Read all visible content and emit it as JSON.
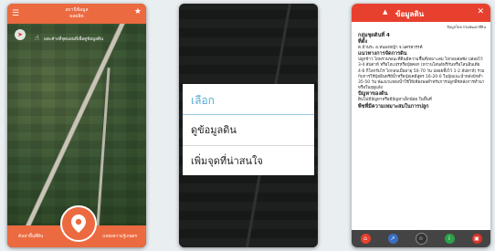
{
  "screen1": {
    "title_line1": "สถานีข้อมูล",
    "title_line2": "ผลผลิต",
    "hint": "แตะค้างที่จุดแผนที่เพื่อดูข้อมูลดิน",
    "left_button": "ค้นหาพื้นที่ดิน",
    "right_button": "แหล่งความรู้เกษตร",
    "menu_icon": "menu-icon",
    "pin_icon": "location-pin-icon"
  },
  "screen2": {
    "sheet_title": "เลือก",
    "options": [
      "ดูข้อมูลดิน",
      "เพิ่มจุดที่น่าสนใจ"
    ]
  },
  "screen3": {
    "header_title": "ข้อมูลดิน",
    "credit": "ข้อมูลโดย กรมพัฒนาที่ดิน",
    "soil_group": "กลุ่มชุดดินที่ 4",
    "location_label": "ที่ตั้ง",
    "location": "ต.บ้านระ อ.หนองหญ้า จ.นครสวรรค์",
    "mgmt_heading": "แนวทางการจัดการดิน",
    "mgmt_text": "ปลูกข้าว ไถพรวนขณะที่ดินมีความชื้นที่เหมาะสม ไถกลบตอซัง ปล่อยไว้ 3-4 สัปดาห์ หรือไถแปรหรือปุ๋ยคอก (หว่านโสนอัฟริกันหรือโสนอินเดีย 4-6 กิโลกรัมไร่ ไถกลบเมื่ออายุ 50-70 วัน ปล่อยทิ้งไว้ 1-2 สัปดาห์) ร่วมกับการใช้ปุ๋ยอินทรีย์น้ำหรือปุ๋ยเคมีสูตร 16-20-0 ในปุ๋ยแนะนำหลังปักดำ 35-50 วัน พัฒนาแหล่งน้ำใช้ให้เพียงพอสำหรับการปลูกพืชหลังการทำนาหรือในฤดูแล้ง",
    "problem_heading": "ปัญหาของดิน",
    "problem_text": "ดินไม่มีปัญหาหรือมีปัญหาเล็กน้อย ในพื้นที่",
    "suitable_heading": "พืชที่มีความเหมาะสมในการปลูก"
  }
}
